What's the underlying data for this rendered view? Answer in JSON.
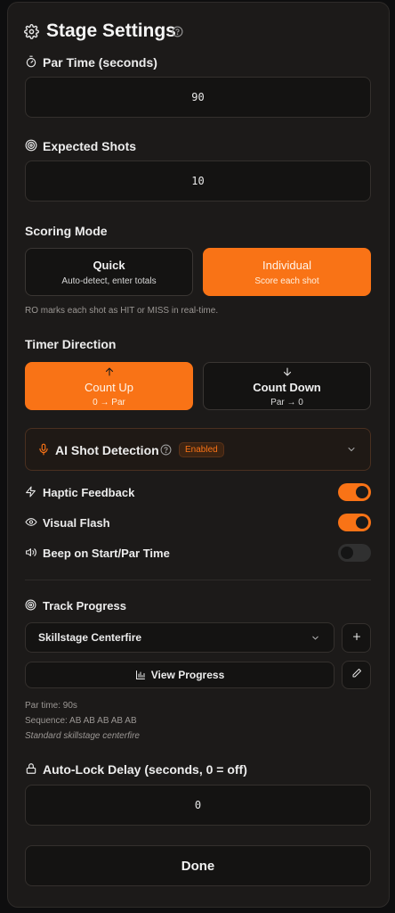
{
  "header": {
    "title": "Stage Settings",
    "help_icon": "question-circle-icon",
    "gear_icon": "gear-icon"
  },
  "par_time": {
    "label": "Par Time (seconds)",
    "value": "90",
    "icon": "stopwatch-icon"
  },
  "expected_shots": {
    "label": "Expected Shots",
    "value": "10",
    "icon": "target-icon"
  },
  "scoring": {
    "label": "Scoring Mode",
    "options": [
      {
        "title": "Quick",
        "subtitle": "Auto-detect, enter totals",
        "active": false
      },
      {
        "title": "Individual",
        "subtitle": "Score each shot",
        "active": true
      }
    ],
    "hint": "RO marks each shot as HIT or MISS in real-time."
  },
  "timer": {
    "label": "Timer Direction",
    "options": [
      {
        "title": "Count Up",
        "subtitle": "0 → Par",
        "active": true,
        "icon": "arrow-up-icon"
      },
      {
        "title": "Count Down",
        "subtitle": "Par → 0",
        "active": false,
        "icon": "arrow-down-icon"
      }
    ]
  },
  "ai_detection": {
    "label": "AI Shot Detection",
    "badge": "Enabled",
    "icon": "microphone-icon"
  },
  "toggles": [
    {
      "label": "Haptic Feedback",
      "on": true,
      "icon": "lightning-icon"
    },
    {
      "label": "Visual Flash",
      "on": true,
      "icon": "eye-icon"
    },
    {
      "label": "Beep on Start/Par Time",
      "on": false,
      "icon": "speaker-icon"
    }
  ],
  "track": {
    "label": "Track Progress",
    "selected": "Skillstage Centerfire",
    "view_label": "View Progress",
    "info": {
      "par": "Par time: 90s",
      "sequence": "Sequence: AB AB AB AB AB",
      "description": "Standard skillstage centerfire"
    }
  },
  "auto_lock": {
    "label": "Auto-Lock Delay (seconds, 0 = off)",
    "value": "0",
    "icon": "lock-icon"
  },
  "done_label": "Done",
  "colors": {
    "accent": "#f97316",
    "panel": "#1c1a19",
    "field": "#141312"
  }
}
